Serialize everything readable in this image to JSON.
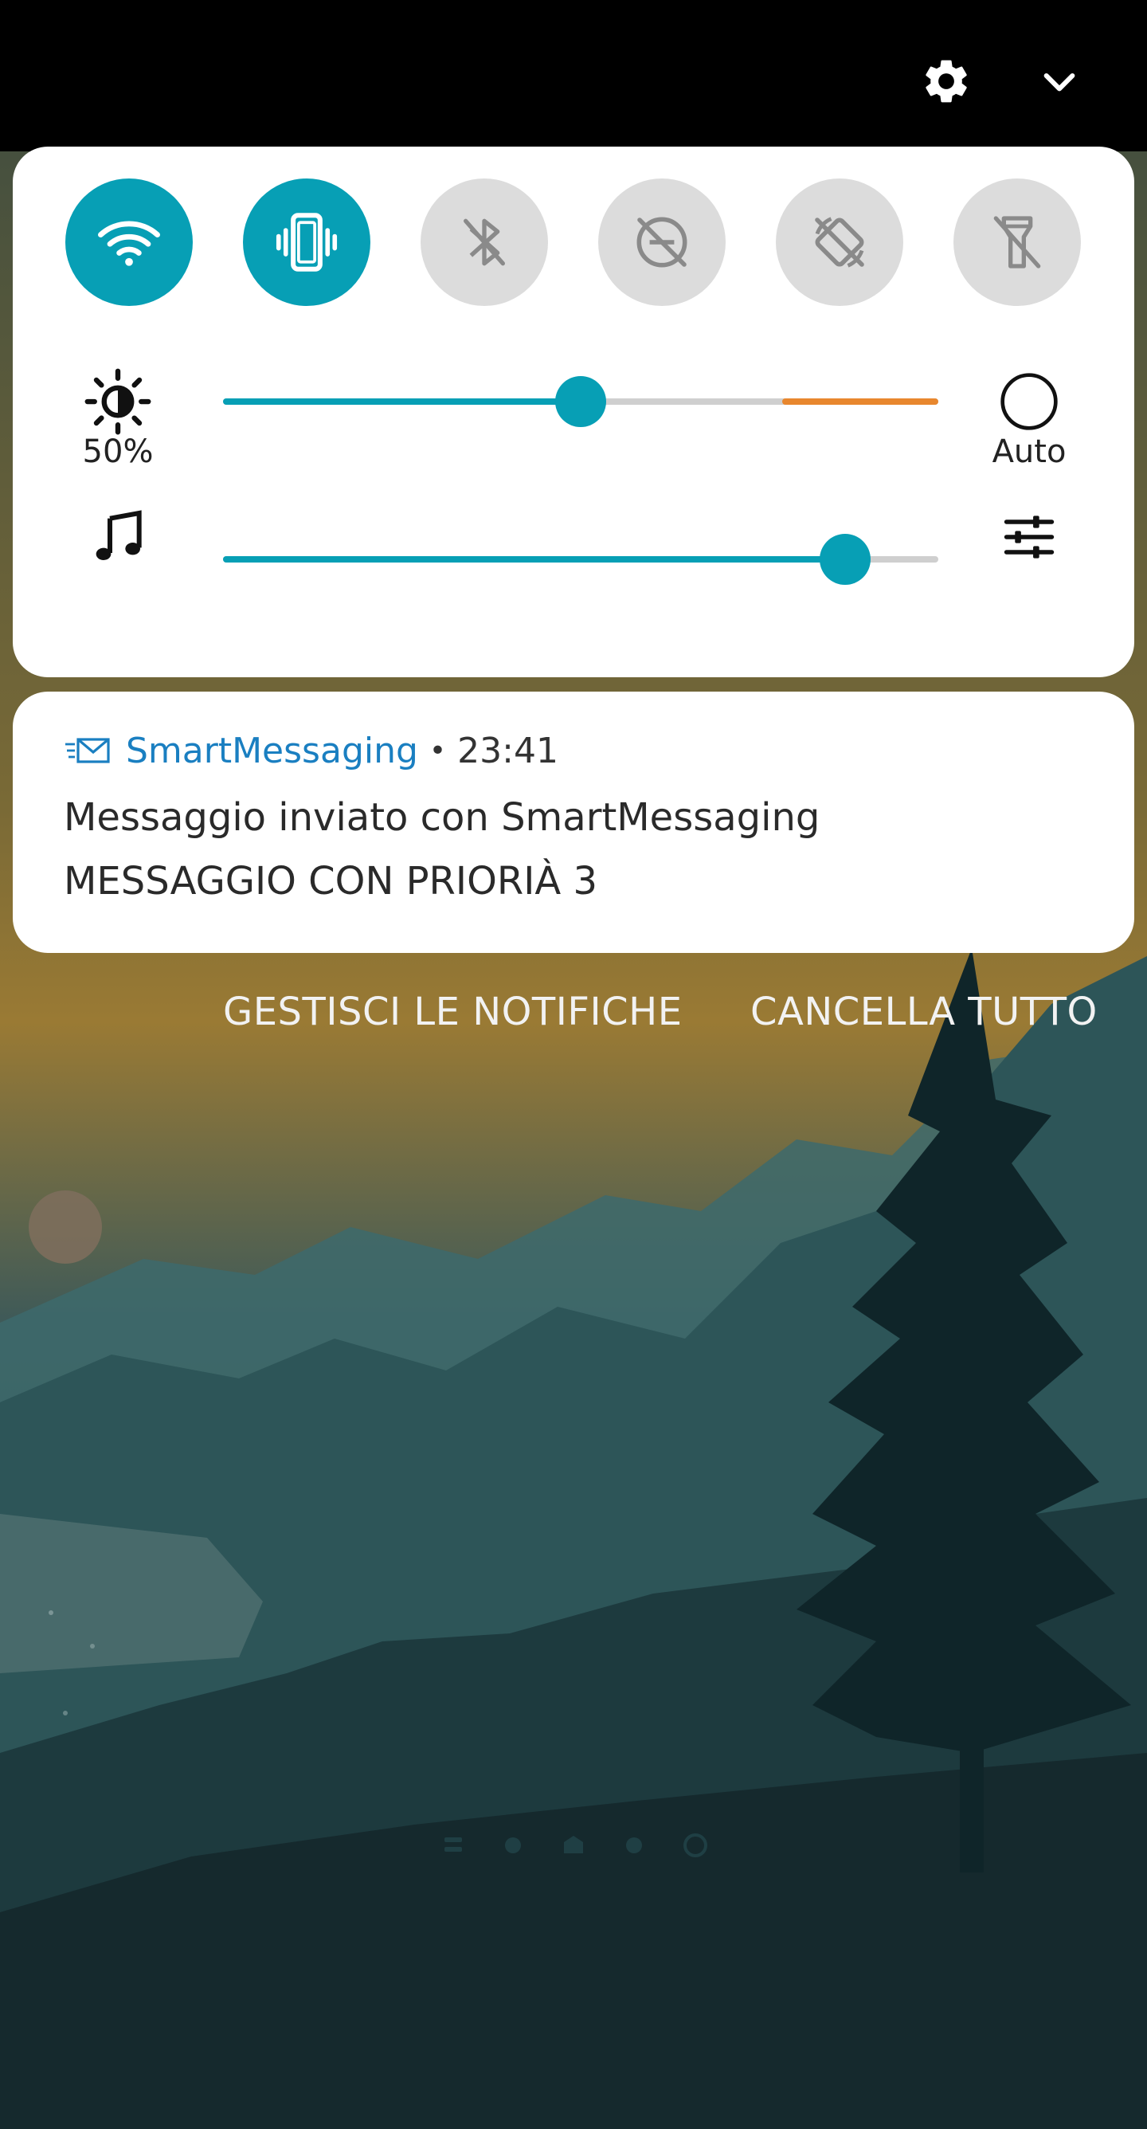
{
  "quick_tiles": [
    {
      "name": "Wi-Fi",
      "icon": "wifi-icon",
      "state": "on"
    },
    {
      "name": "Vibration",
      "icon": "vibrate-icon",
      "state": "on"
    },
    {
      "name": "Bluetooth",
      "icon": "bluetooth-off-icon",
      "state": "off"
    },
    {
      "name": "Do not disturb",
      "icon": "dnd-off-icon",
      "state": "off"
    },
    {
      "name": "Auto-rotate",
      "icon": "rotate-off-icon",
      "state": "off"
    },
    {
      "name": "Flashlight",
      "icon": "flashlight-off-icon",
      "state": "off"
    }
  ],
  "brightness": {
    "label": "50%",
    "level": 0.5,
    "auto_label": "Auto"
  },
  "volume": {
    "level": 0.87
  },
  "notification": {
    "app_name": "SmartMessaging",
    "separator": "•",
    "time": "23:41",
    "title": "Messaggio inviato con SmartMessaging",
    "body": "MESSAGGIO CON PRIORIÀ 3"
  },
  "actions": {
    "manage": "GESTISCI LE NOTIFICHE",
    "clear_all": "CANCELLA TUTTO"
  },
  "colors": {
    "accent": "#079fb5",
    "warning": "#e8872e",
    "app_name": "#1a7fc1"
  }
}
